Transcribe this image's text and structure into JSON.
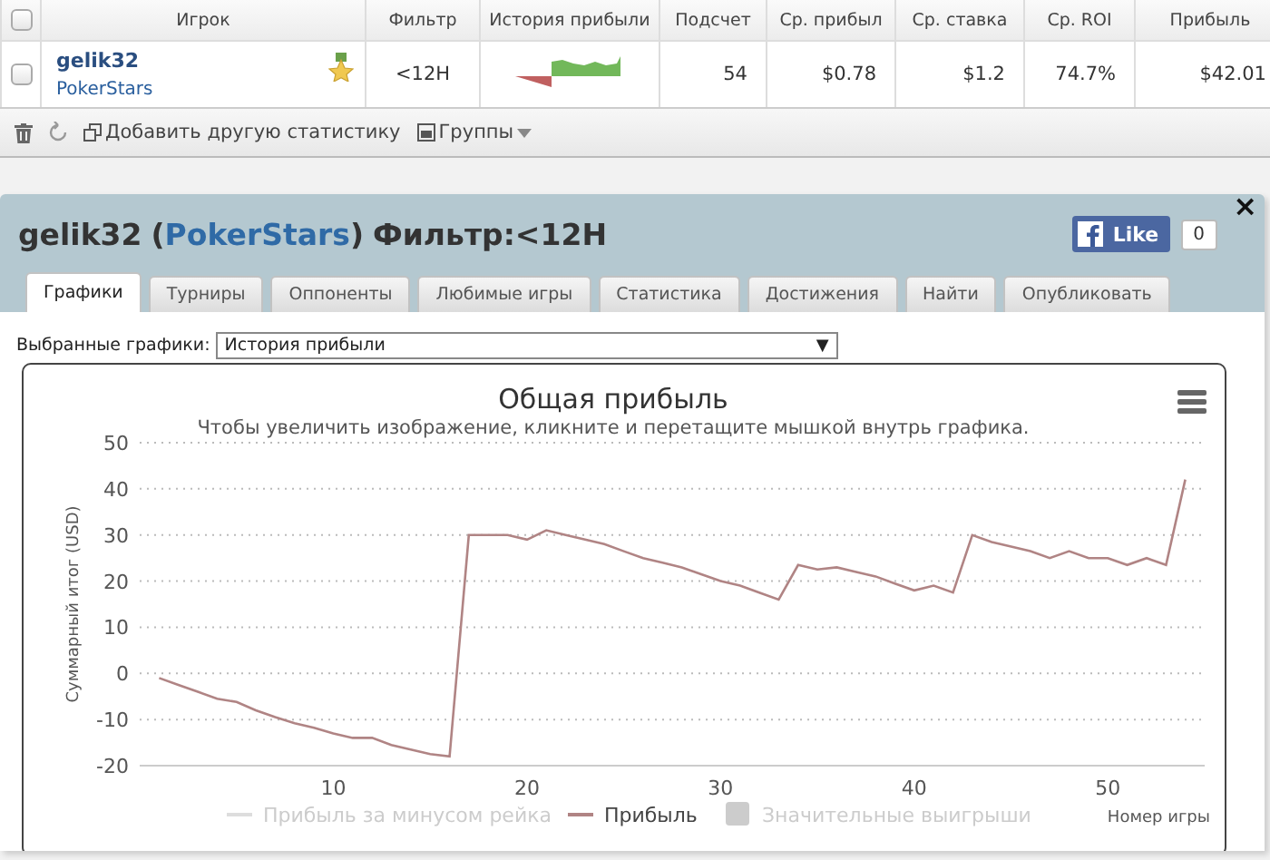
{
  "table": {
    "columns": [
      "Игрок",
      "Фильтр",
      "История прибыли",
      "Подсчет",
      "Ср. прибыл",
      "Ср. ставка",
      "Ср. ROI",
      "Прибыль"
    ],
    "header_checked": false,
    "rows": [
      {
        "checked": false,
        "player": "gelik32",
        "site": "PokerStars",
        "filter": "<12H",
        "count": "54",
        "avg_profit": "$0.78",
        "avg_stake": "$1.2",
        "avg_roi": "74.7%",
        "profit": "$42.01"
      }
    ]
  },
  "toolbar": {
    "add_stat": "Добавить другую статистику",
    "groups": "Группы"
  },
  "panel": {
    "player": "gelik32",
    "open_paren": "(",
    "site": "PokerStars",
    "close_paren": ")",
    "filter": "Фильтр:<12H",
    "like": "Like",
    "like_count": "0",
    "close": "×",
    "tabs": [
      {
        "label": "Графики",
        "selected": true
      },
      {
        "label": "Турниры",
        "selected": false
      },
      {
        "label": "Оппоненты",
        "selected": false
      },
      {
        "label": "Любимые игры",
        "selected": false
      },
      {
        "label": "Статистика",
        "selected": false
      },
      {
        "label": "Достижения",
        "selected": false
      },
      {
        "label": "Найти",
        "selected": false
      },
      {
        "label": "Опубликовать",
        "selected": false
      }
    ],
    "chart_select": {
      "label": "Выбранные графики:",
      "value": "История прибыли",
      "arrow": "▼"
    },
    "chart": {
      "subtitle": "Чтобы увеличить изображение, кликните и перетащите мышкой внутрь графика.",
      "legend": [
        {
          "label": "Прибыль за минусом рейка",
          "kind": "line",
          "visible": false
        },
        {
          "kind": "series",
          "visible": true
        },
        {
          "label": "Значительные выигрыши",
          "kind": "box",
          "visible": false
        }
      ],
      "chart_data": {
        "type": "line",
        "title": "Общая прибыль",
        "xlabel": "Номер игры",
        "ylabel": "Суммарный итог (USD)",
        "xlim": [
          0,
          55
        ],
        "grid": true,
        "ylim": [
          -20,
          50
        ],
        "xticks": [
          10,
          20,
          30,
          40,
          50
        ],
        "yticks": [
          -20,
          -10,
          0,
          10,
          20,
          30,
          40,
          50
        ],
        "x": [
          1,
          2,
          3,
          4,
          5,
          6,
          7,
          8,
          9,
          10,
          11,
          12,
          13,
          14,
          15,
          16,
          17,
          18,
          19,
          20,
          21,
          22,
          23,
          24,
          25,
          26,
          27,
          28,
          29,
          30,
          31,
          32,
          33,
          34,
          35,
          36,
          37,
          38,
          39,
          40,
          41,
          42,
          43,
          44,
          45,
          46,
          47,
          48,
          49,
          50,
          51,
          52,
          53,
          54
        ],
        "series": [
          {
            "name": "Прибыль",
            "color": "#b08484",
            "values": [
              -1,
              -2.5,
              -4,
              -5.5,
              -6.2,
              -8,
              -9.5,
              -10.8,
              -11.8,
              -13,
              -14,
              -14,
              -15.5,
              -16.5,
              -17.5,
              -18,
              30,
              30,
              30,
              29,
              31,
              30,
              29,
              28,
              26.5,
              25,
              24,
              23,
              21.5,
              20,
              19,
              17.5,
              16,
              23.5,
              22.5,
              23,
              22,
              21,
              19.5,
              18,
              19,
              17.5,
              30,
              28.5,
              27.5,
              26.5,
              25,
              26.5,
              25,
              25,
              23.5,
              25,
              23.5,
              42
            ]
          }
        ]
      }
    }
  }
}
